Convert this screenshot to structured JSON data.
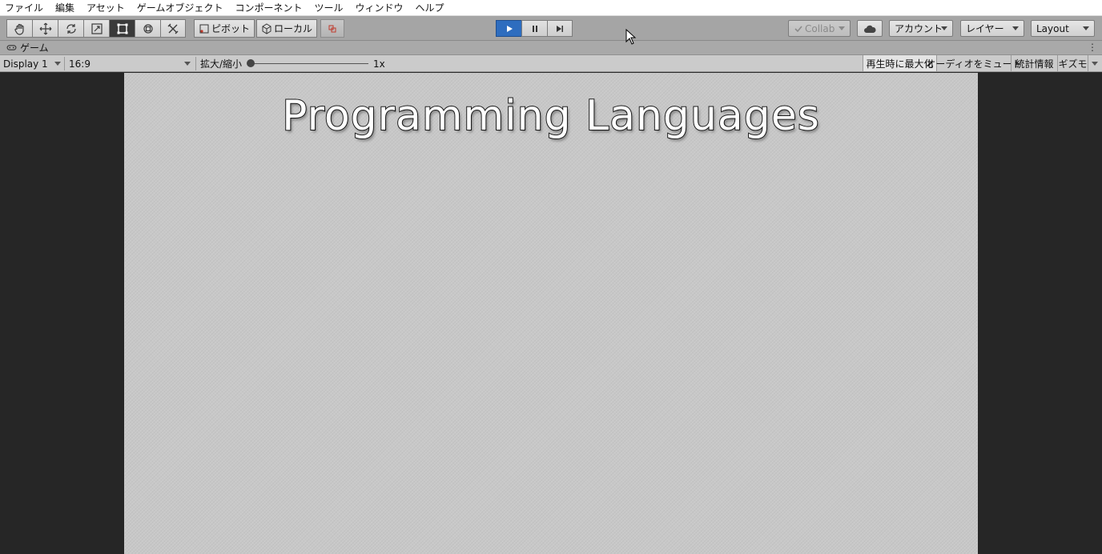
{
  "menu": [
    "ファイル",
    "編集",
    "アセット",
    "ゲームオブジェクト",
    "コンポーネント",
    "ツール",
    "ウィンドウ",
    "ヘルプ"
  ],
  "toolbar": {
    "tools": [
      "hand-tool-icon",
      "move-tool-icon",
      "rotate-tool-icon",
      "scale-tool-icon",
      "rect-tool-icon",
      "transform-tool-icon",
      "custom-tool-icon"
    ],
    "active_tool": "rect-tool-icon",
    "pivot_label": "ピボット",
    "local_label": "ローカル",
    "collab_label": "Collab",
    "account_label": "アカウント",
    "layers_label": "レイヤー",
    "layout_label": "Layout"
  },
  "game_tab": {
    "label": "ゲーム"
  },
  "game_bar": {
    "display": "Display 1",
    "aspect": "16:9",
    "scale_label": "拡大/縮小",
    "scale_value": "1x",
    "maximize_label": "再生時に最大化",
    "mute_label": "オーディオをミュート",
    "stats_label": "統計情報",
    "gizmos_label": "ギズモ"
  },
  "game_view": {
    "title": "Programming Languages"
  },
  "colors": {
    "play_active": "#2e6dbf",
    "viewport_bg": "#262626",
    "canvas_bg": "#c8c8c8"
  }
}
